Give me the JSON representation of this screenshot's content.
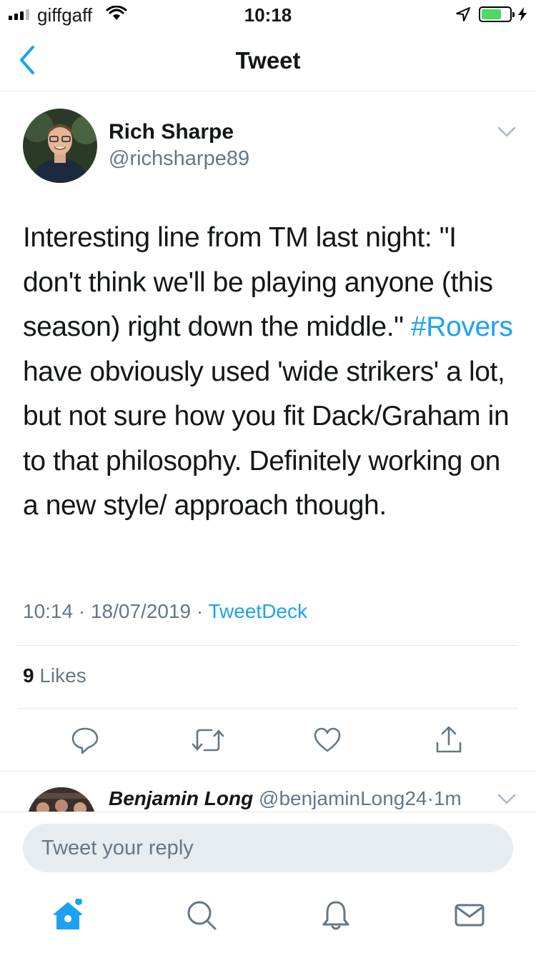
{
  "status_bar": {
    "carrier": "giffgaff",
    "time": "10:18",
    "battery_level": 0.7
  },
  "nav": {
    "title": "Tweet"
  },
  "tweet": {
    "author_name": "Rich Sharpe",
    "author_handle": "@richsharpe89",
    "text_part1": "Interesting line from TM last night: \"I don't think we'll be playing anyone (this season) right down the middle.\" ",
    "hashtag": "#Rovers",
    "text_part2": " have obviously used 'wide strikers' a lot, but not sure how you fit Dack/Graham in to that philosophy. Definitely working on a new style/ approach though.",
    "time": "10:14",
    "date": "18/07/2019",
    "separator": "·",
    "source": "TweetDeck",
    "likes_count": "9",
    "likes_label": "Likes"
  },
  "reply_preview": {
    "name": "Benjamin Long",
    "handle": "@benjaminLong24",
    "age": "1m"
  },
  "compose": {
    "placeholder": "Tweet your reply"
  },
  "icons": {
    "back": "chevron-left-icon",
    "caret": "chevron-down-icon",
    "reply": "comment-bubble-icon",
    "retweet": "retweet-icon",
    "like": "heart-icon",
    "share": "share-icon",
    "home": "home-icon",
    "search": "search-icon",
    "notifications": "bell-icon",
    "messages": "envelope-icon"
  },
  "colors": {
    "accent": "#1da1f2",
    "secondary_text": "#657786",
    "divider": "#e1e8ed"
  }
}
